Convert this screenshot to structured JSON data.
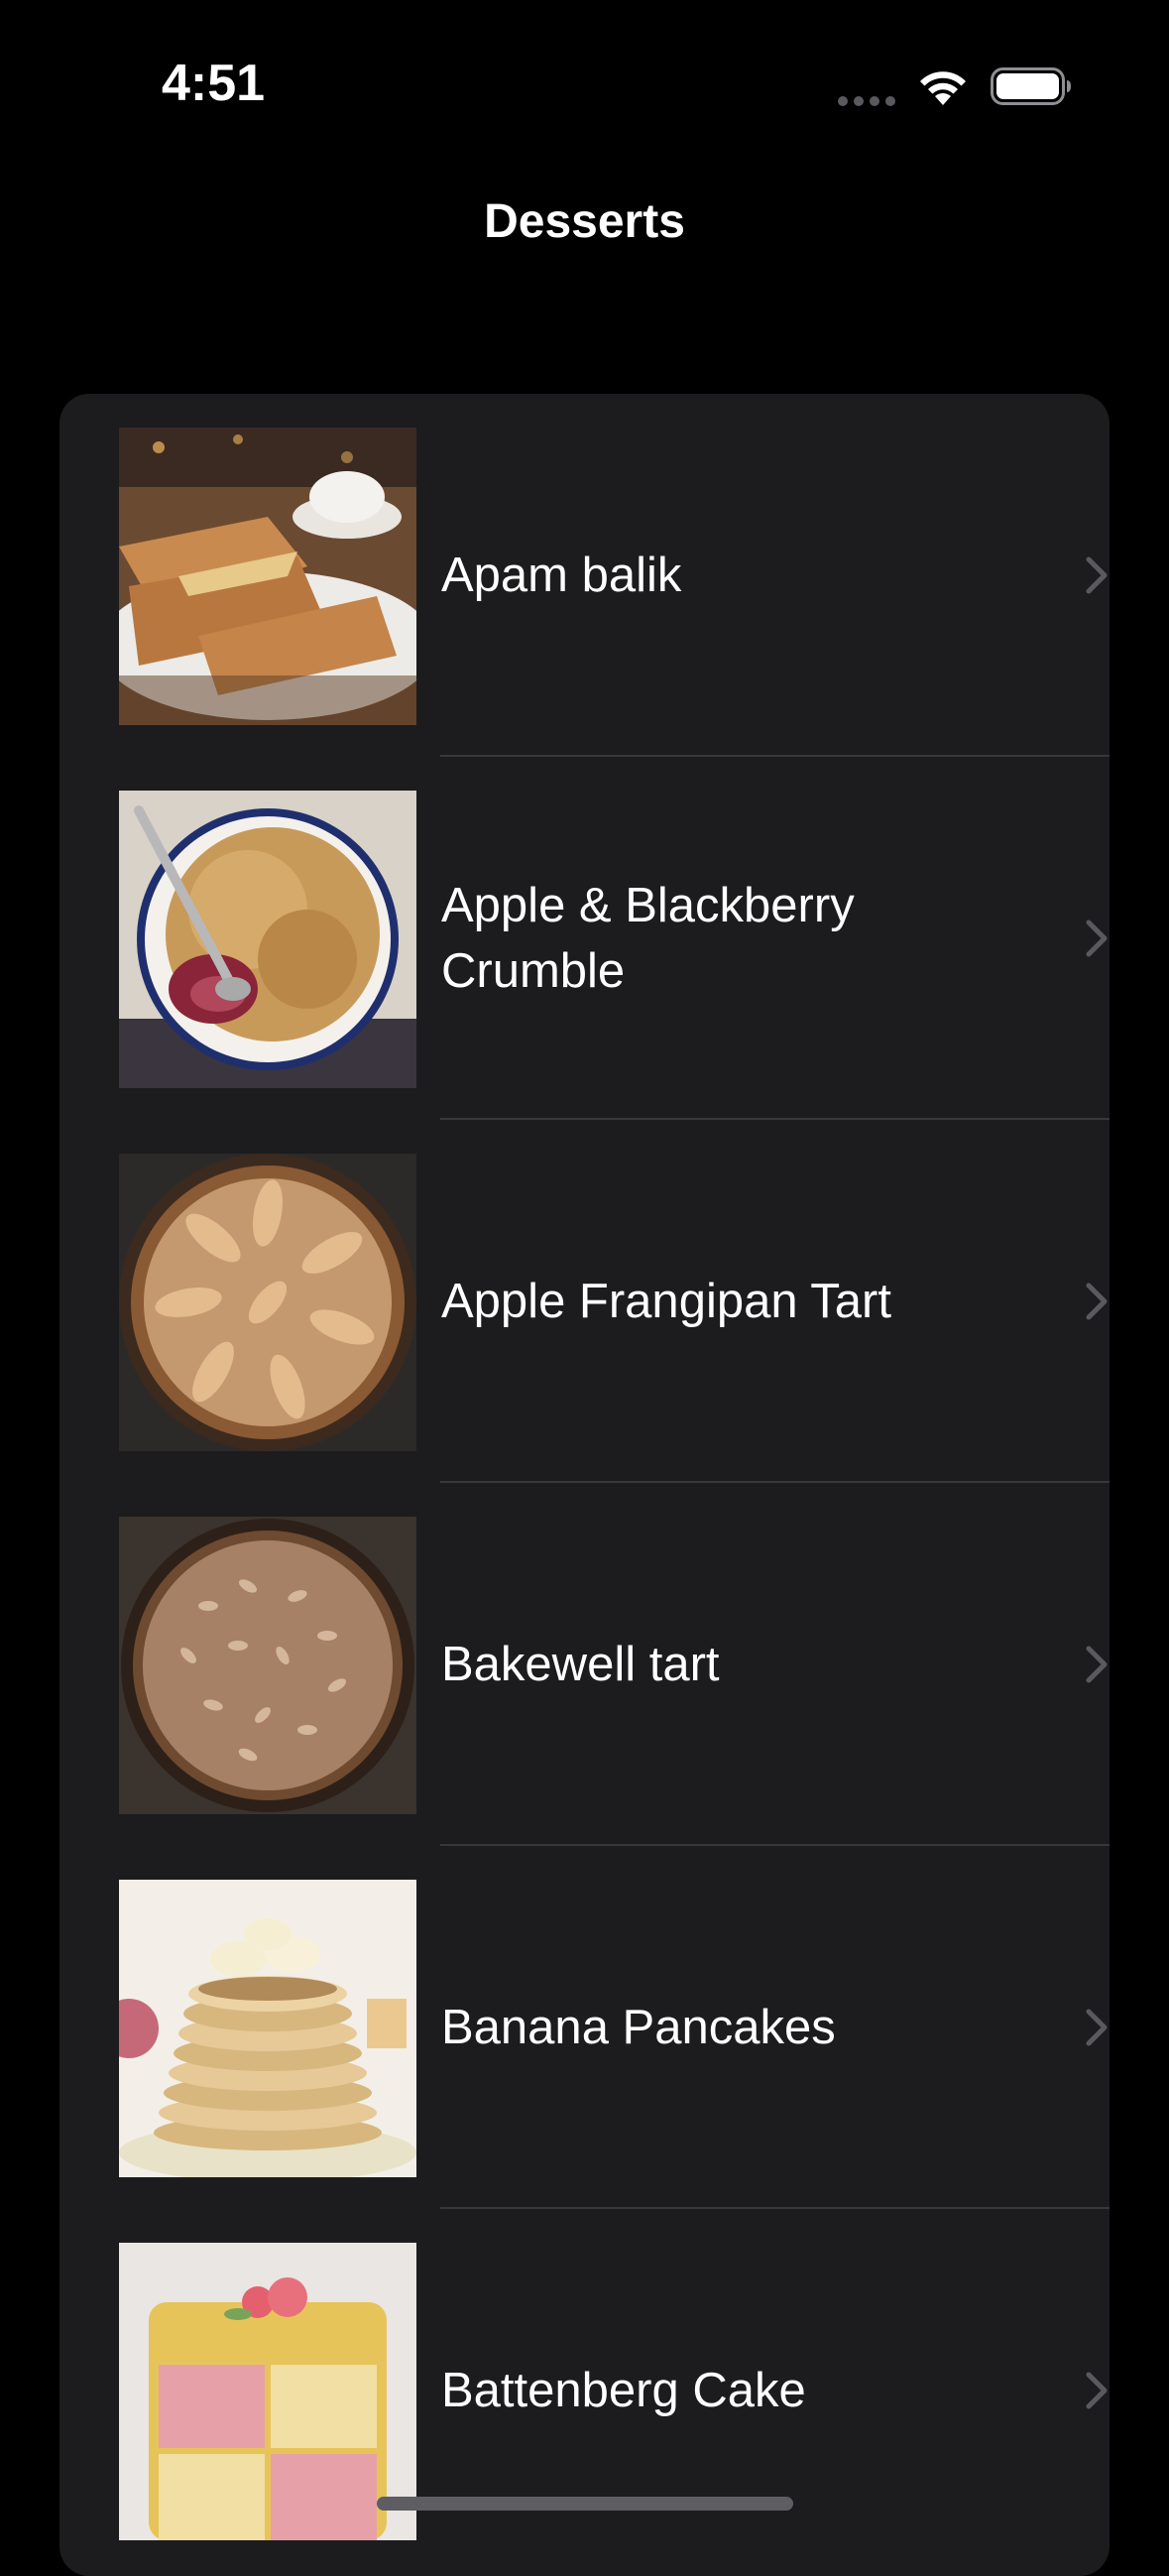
{
  "status_bar": {
    "time": "4:51",
    "icons": [
      "cellular-dots-icon",
      "wifi-icon",
      "battery-icon"
    ]
  },
  "nav": {
    "title": "Desserts"
  },
  "colors": {
    "background": "#000000",
    "card": "#1c1c1e",
    "separator": "#38383a",
    "chevron": "#5a5a5e",
    "text": "#ffffff"
  },
  "list": {
    "items": [
      {
        "label": "Apam balik",
        "image": "apam-balik-photo"
      },
      {
        "label": "Apple & Blackberry Crumble",
        "image": "crumble-photo"
      },
      {
        "label": "Apple Frangipan Tart",
        "image": "frangipan-tart-photo"
      },
      {
        "label": "Bakewell tart",
        "image": "bakewell-tart-photo"
      },
      {
        "label": "Banana Pancakes",
        "image": "banana-pancakes-photo"
      },
      {
        "label": "Battenberg Cake",
        "image": "battenberg-cake-photo"
      }
    ]
  }
}
